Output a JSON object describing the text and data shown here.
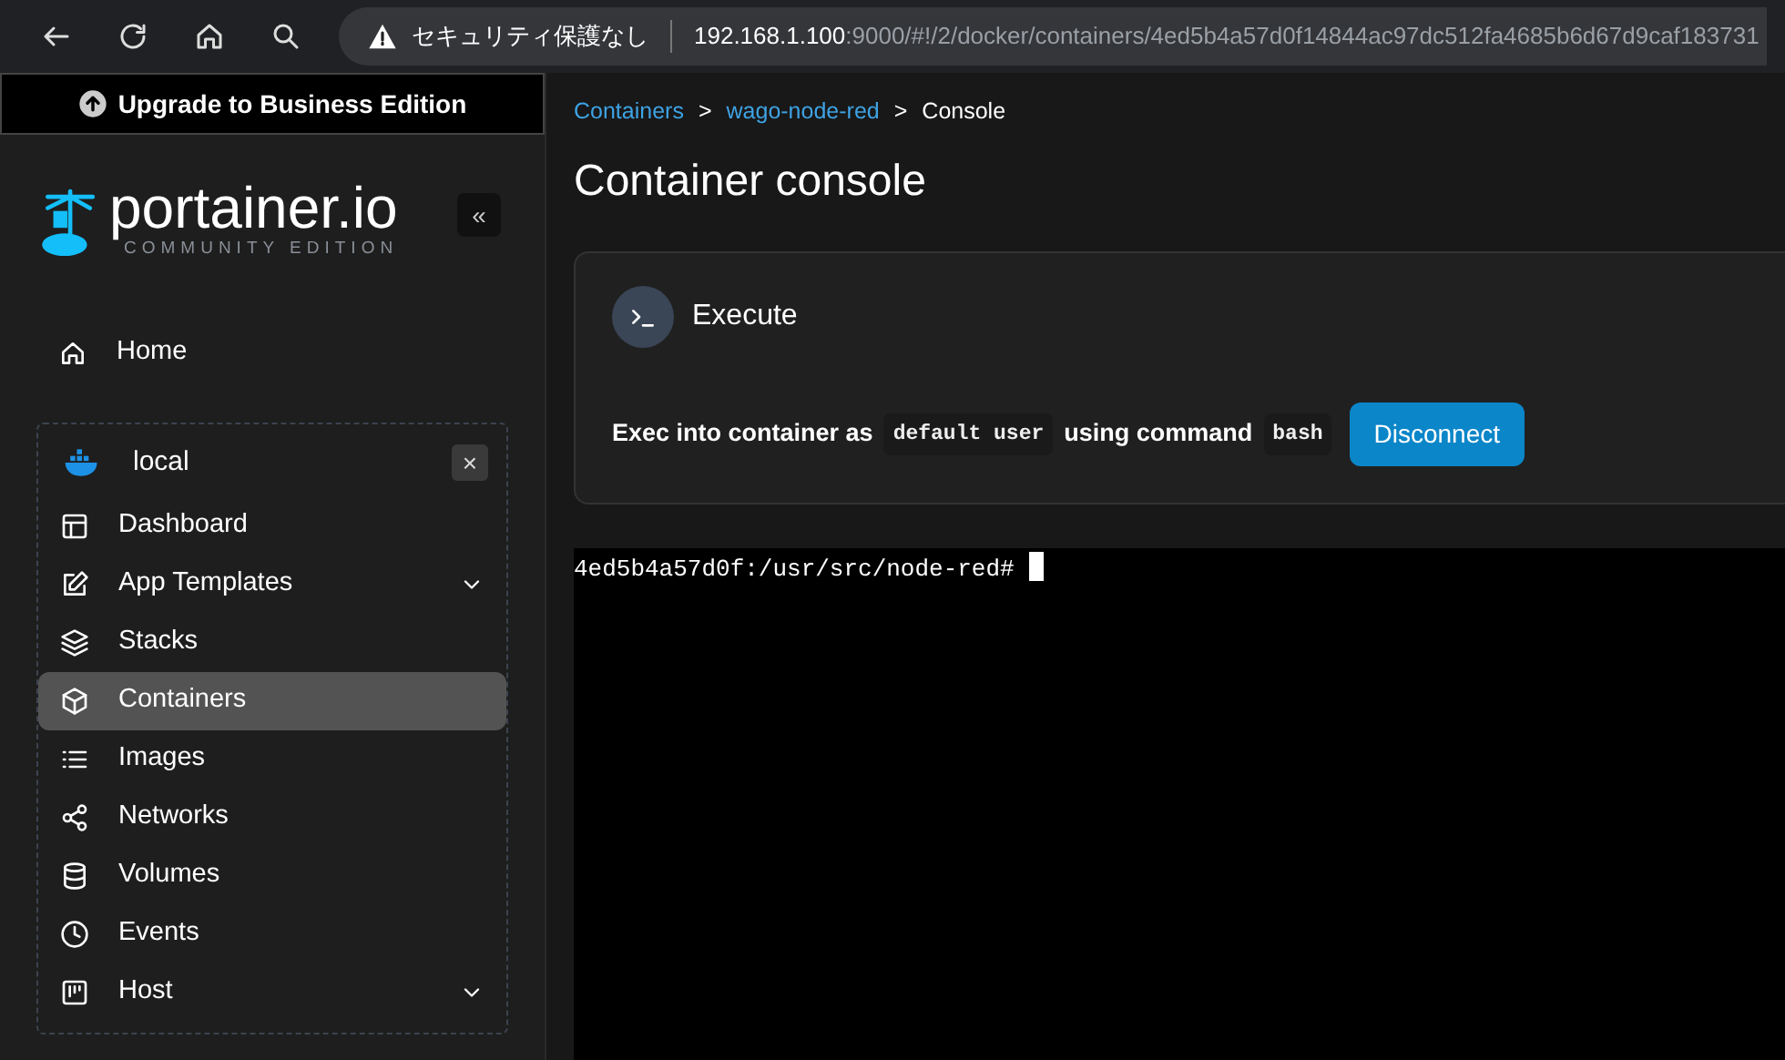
{
  "browser": {
    "security_label": "セキュリティ保護なし",
    "url_host": "192.168.1.100",
    "url_rest": ":9000/#!/2/docker/containers/4ed5b4a57d0f14844ac97dc512fa4685b6d67d9caf183731"
  },
  "sidebar": {
    "upgrade": "Upgrade to Business Edition",
    "logo_text": "portainer.io",
    "logo_sub": "COMMUNITY EDITION",
    "collapse": "«",
    "home": {
      "label": "Home"
    },
    "environment": {
      "name": "local",
      "close": "×",
      "items": [
        {
          "label": "Dashboard",
          "selected": false,
          "chevron": false
        },
        {
          "label": "App Templates",
          "selected": false,
          "chevron": true
        },
        {
          "label": "Stacks",
          "selected": false,
          "chevron": false
        },
        {
          "label": "Containers",
          "selected": true,
          "chevron": false
        },
        {
          "label": "Images",
          "selected": false,
          "chevron": false
        },
        {
          "label": "Networks",
          "selected": false,
          "chevron": false
        },
        {
          "label": "Volumes",
          "selected": false,
          "chevron": false
        },
        {
          "label": "Events",
          "selected": false,
          "chevron": false
        },
        {
          "label": "Host",
          "selected": false,
          "chevron": true
        }
      ]
    }
  },
  "breadcrumbs": [
    {
      "label": "Containers",
      "link": true
    },
    {
      "label": "wago-node-red",
      "link": true
    },
    {
      "label": "Console",
      "link": false
    }
  ],
  "breadcrumb_sep": ">",
  "title": "Container console",
  "execute": {
    "title": "Execute",
    "text_1": "Exec into container as",
    "user": "default user",
    "text_2": "using command",
    "command": "bash",
    "button": "Disconnect"
  },
  "terminal": {
    "prompt": "4ed5b4a57d0f:/usr/src/node-red#"
  }
}
